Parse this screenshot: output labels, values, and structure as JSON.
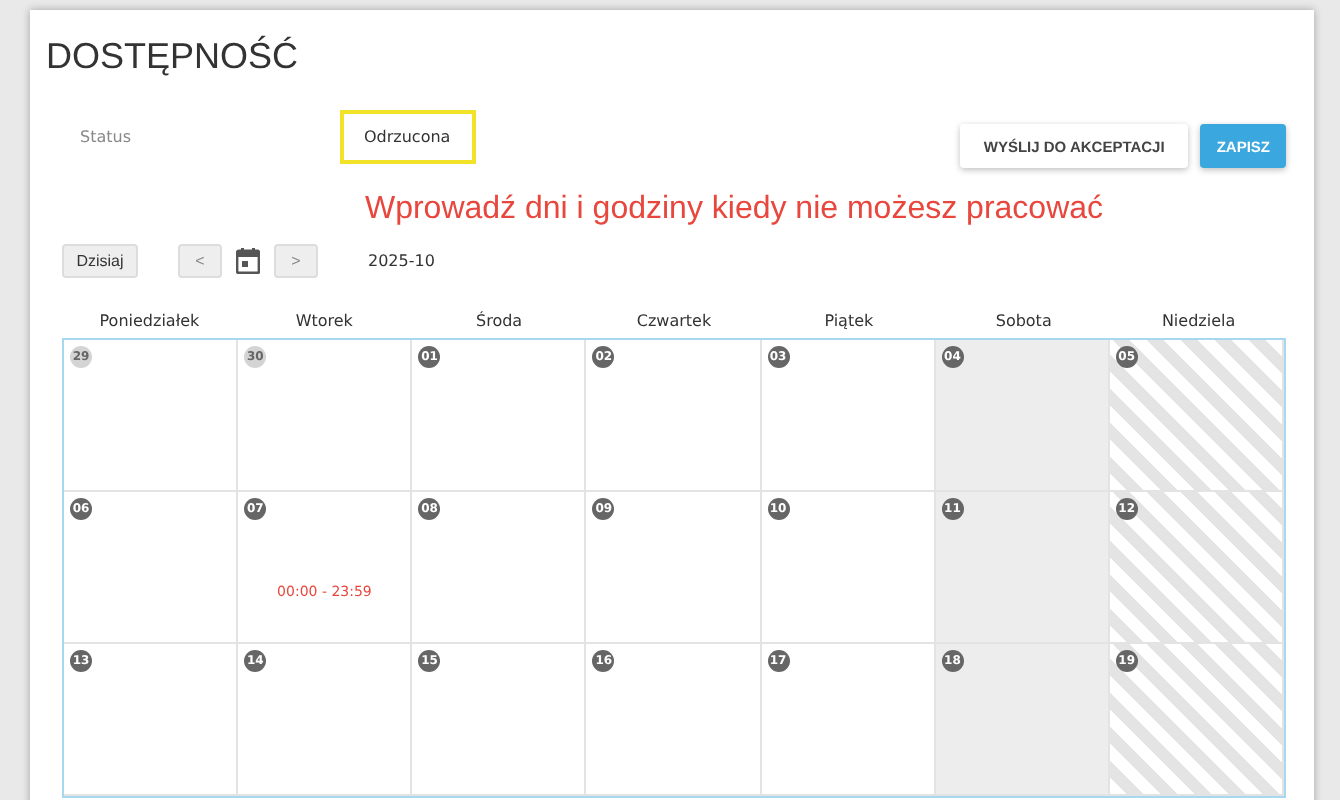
{
  "title": "DOSTĘPNOŚĆ",
  "status": {
    "label": "Status",
    "value": "Odrzucona"
  },
  "buttons": [
    {
      "label": "WYŚLIJ DO AKCEPTACJI",
      "kind": "secondary"
    },
    {
      "label": "ZAPISZ",
      "kind": "primary"
    }
  ],
  "notice": "Wprowadź dni i godziny kiedy nie możesz pracować",
  "toolbar": {
    "today": "Dzisiaj",
    "prev": "<",
    "next": ">",
    "month": "2025-10"
  },
  "calendar": {
    "weekdays": [
      "Poniedziałek",
      "Wtorek",
      "Środa",
      "Czwartek",
      "Piątek",
      "Sobota",
      "Niedziela"
    ],
    "weeks": [
      [
        {
          "day": "29",
          "kind": "weekday",
          "outside": true
        },
        {
          "day": "30",
          "kind": "weekday",
          "outside": true
        },
        {
          "day": "01",
          "kind": "weekday",
          "outside": false
        },
        {
          "day": "02",
          "kind": "weekday",
          "outside": false
        },
        {
          "day": "03",
          "kind": "weekday",
          "outside": false
        },
        {
          "day": "04",
          "kind": "saturday",
          "outside": false
        },
        {
          "day": "05",
          "kind": "sunday",
          "outside": false
        }
      ],
      [
        {
          "day": "06",
          "kind": "weekday",
          "outside": false
        },
        {
          "day": "07",
          "kind": "weekday",
          "outside": false,
          "event": "00:00 - 23:59"
        },
        {
          "day": "08",
          "kind": "weekday",
          "outside": false
        },
        {
          "day": "09",
          "kind": "weekday",
          "outside": false
        },
        {
          "day": "10",
          "kind": "weekday",
          "outside": false
        },
        {
          "day": "11",
          "kind": "saturday",
          "outside": false
        },
        {
          "day": "12",
          "kind": "sunday",
          "outside": false
        }
      ],
      [
        {
          "day": "13",
          "kind": "weekday",
          "outside": false
        },
        {
          "day": "14",
          "kind": "weekday",
          "outside": false
        },
        {
          "day": "15",
          "kind": "weekday",
          "outside": false
        },
        {
          "day": "16",
          "kind": "weekday",
          "outside": false
        },
        {
          "day": "17",
          "kind": "weekday",
          "outside": false
        },
        {
          "day": "18",
          "kind": "saturday",
          "outside": false
        },
        {
          "day": "19",
          "kind": "sunday",
          "outside": false
        }
      ]
    ]
  }
}
